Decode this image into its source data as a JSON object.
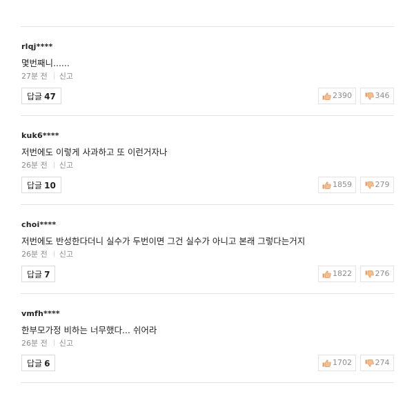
{
  "comments": [
    {
      "username": "rlqj****",
      "text": "몇번째니......",
      "time": "27분 전",
      "report_label": "신고",
      "reply_label": "답글",
      "reply_count": "47",
      "likes": "2390",
      "dislikes": "346"
    },
    {
      "username": "kuk6****",
      "text": "저번에도 이렇게 사과하고 또 이런거자나",
      "time": "26분 전",
      "report_label": "신고",
      "reply_label": "답글",
      "reply_count": "10",
      "likes": "1859",
      "dislikes": "279"
    },
    {
      "username": "choi****",
      "text": "저번에도 반성한다더니 실수가 두번이면 그건 실수가 아니고 본래 그렇다는거지",
      "time": "26분 전",
      "report_label": "신고",
      "reply_label": "답글",
      "reply_count": "7",
      "likes": "1822",
      "dislikes": "276"
    },
    {
      "username": "vmfh****",
      "text": "한부모가정 비하는 너무했다... 쉬어라",
      "time": "26분 전",
      "report_label": "신고",
      "reply_label": "답글",
      "reply_count": "6",
      "likes": "1702",
      "dislikes": "274"
    }
  ],
  "colors": {
    "like_icon": "#e8a06a",
    "dislike_icon": "#e8a06a",
    "divider": "#e3e3e3",
    "meta_text": "#8c8c8c"
  },
  "icons": {
    "like": "thumbs-up-icon",
    "dislike": "thumbs-down-icon"
  }
}
